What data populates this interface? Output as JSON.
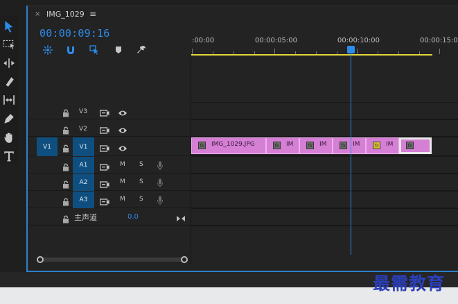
{
  "panel": {
    "tab_close": "×",
    "tab_title": "IMG_1029",
    "tab_menu": "≡",
    "timecode": "00:00:09:16"
  },
  "ruler": {
    "labels": [
      ":00:00",
      "00:00:05:00",
      "00:00:10:00",
      "00:00:15:00"
    ]
  },
  "tracks": {
    "video": [
      {
        "name": "V3"
      },
      {
        "name": "V2"
      },
      {
        "name": "V1",
        "source": "V1"
      }
    ],
    "audio": [
      {
        "name": "A1",
        "mute": "M",
        "solo": "S"
      },
      {
        "name": "A2",
        "mute": "M",
        "solo": "S"
      },
      {
        "name": "A3",
        "mute": "M",
        "solo": "S"
      }
    ],
    "master": {
      "label": "主声道",
      "value": "0.0"
    }
  },
  "clips": [
    {
      "name": "IMG_1029.JPG",
      "fx": "fx"
    },
    {
      "name": "IM",
      "fx": "fx"
    },
    {
      "name": "IM",
      "fx": "fx"
    },
    {
      "name": "IM",
      "fx": "fx"
    },
    {
      "name": "IM",
      "fx": "fx"
    },
    {
      "name": "",
      "fx": "fx"
    }
  ],
  "watermark": "最需教育",
  "colors": {
    "accent": "#2d8ceb",
    "clip": "#d57fd5",
    "ruler_bar": "#e6d53a"
  }
}
